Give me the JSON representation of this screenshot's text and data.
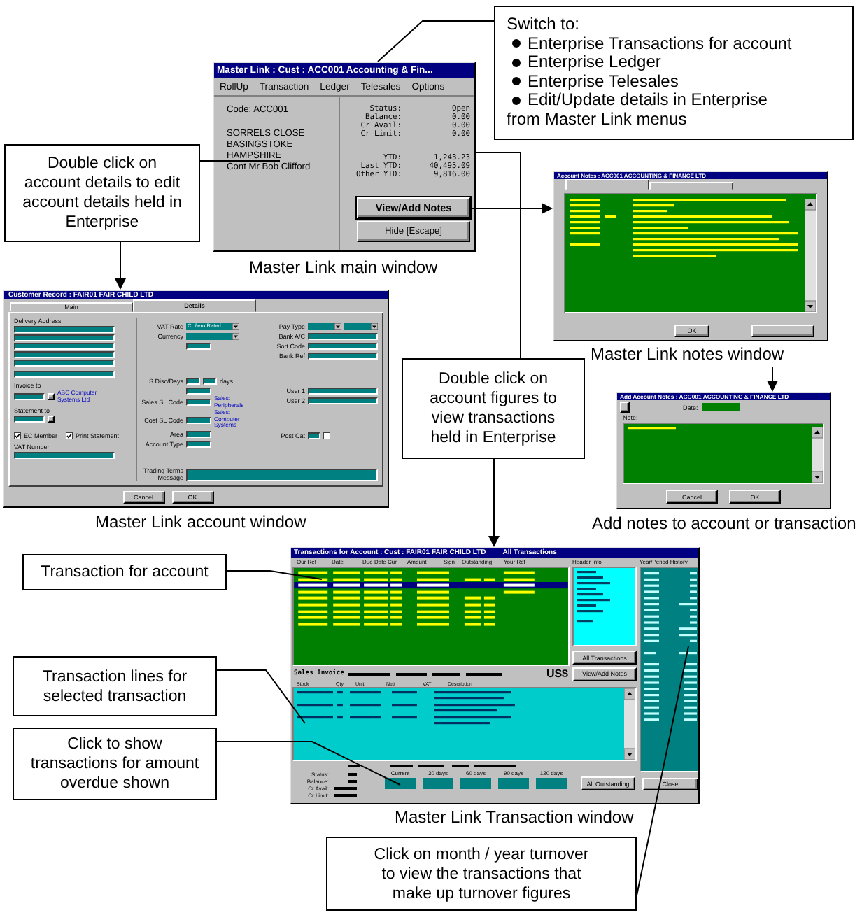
{
  "switch_note": {
    "heading": "Switch to:",
    "items": [
      "Enterprise Transactions for account",
      "Enterprise Ledger",
      "Enterprise Telesales",
      "Edit/Update details in Enterprise"
    ],
    "footer": "from Master Link menus"
  },
  "callouts": [
    {
      "text": "Double click on account details to edit account details held in Enterprise"
    },
    {
      "text": "Double click on account figures to view transactions held in Enterprise"
    },
    {
      "text": "Transaction for account"
    },
    {
      "text": "Transaction lines for selected transaction"
    },
    {
      "text": "Click to show transactions for amount overdue shown"
    },
    {
      "text": "Click on month / year turnover to view the transactions that make up turnover figures"
    }
  ],
  "main_window": {
    "title": "Master Link : Cust : ACC001 Accounting & Fin...",
    "menu": [
      "RollUp",
      "Transaction",
      "Ledger",
      "Telesales",
      "Options"
    ],
    "code": "Code: ACC001",
    "address": [
      "SORRELS CLOSE",
      "BASINGSTOKE",
      "HAMPSHIRE",
      "Cont Mr Bob Clifford"
    ],
    "status_figures": [
      {
        "label": "Status:",
        "value": "Open"
      },
      {
        "label": "Balance:",
        "value": "0.00"
      },
      {
        "label": "Cr Avail:",
        "value": "0.00"
      },
      {
        "label": "Cr Limit:",
        "value": "0.00"
      }
    ],
    "turnover_figures": [
      {
        "label": "YTD:",
        "value": "1,243.23"
      },
      {
        "label": "Last YTD:",
        "value": "40,495.09"
      },
      {
        "label": "Other YTD:",
        "value": "9,816.00"
      }
    ],
    "buttons": [
      {
        "label": "View/Add Notes",
        "default": true
      },
      {
        "label": "Hide [Escape]",
        "default": false
      }
    ],
    "caption": "Master Link main window"
  },
  "account_window": {
    "title": "Customer Record : FAIR01 FAIR CHILD LTD",
    "tabs": [
      {
        "label": "Main",
        "selected": false
      },
      {
        "label": "Details",
        "selected": true
      }
    ],
    "left": [
      [
        {
          "kind": "heading",
          "label": "Delivery Address"
        },
        {
          "kind": "field"
        },
        {
          "kind": "field"
        },
        {
          "kind": "field"
        },
        {
          "kind": "field"
        },
        {
          "kind": "field"
        }
      ],
      [
        {
          "kind": "field"
        }
      ],
      [
        {
          "kind": "heading",
          "label": "Invoice to"
        },
        {
          "kind": "lookup",
          "link": "ABC Computer Systems Ltd"
        }
      ],
      [
        {
          "kind": "heading",
          "label": "Statement to"
        },
        {
          "kind": "lookup"
        }
      ],
      [
        {
          "kind": "checks",
          "items": [
            {
              "label": "EC Member",
              "checked": true
            },
            {
              "label": "Print Statement",
              "checked": true
            }
          ]
        }
      ],
      [
        {
          "kind": "heading",
          "label": "VAT Number"
        },
        {
          "kind": "field"
        }
      ]
    ],
    "middle": [
      [
        {
          "label": "VAT Rate",
          "controls": [
            {
              "kind": "dropdown",
              "value": "C: Zero Rated"
            }
          ]
        },
        {
          "label": "Currency",
          "controls": [
            {
              "kind": "dropdown"
            }
          ]
        },
        {
          "controls": [
            {
              "kind": "field"
            }
          ]
        }
      ],
      [
        {
          "label": "S Disc/Days",
          "controls": [
            {
              "kind": "field"
            },
            {
              "kind": "field"
            }
          ],
          "suffix": "days"
        },
        {
          "controls": [
            {
              "kind": "field"
            }
          ]
        },
        {
          "label": "Sales SL Code",
          "controls": [
            {
              "kind": "field"
            }
          ],
          "link": "Sales: Peripherals"
        },
        {
          "label": "Cost SL Code",
          "controls": [
            {
              "kind": "field"
            }
          ],
          "link": "Sales: Computer Systems"
        },
        {
          "label": "Area",
          "controls": [
            {
              "kind": "field"
            }
          ]
        },
        {
          "label": "Account Type",
          "controls": [
            {
              "kind": "field"
            }
          ]
        }
      ]
    ],
    "right": [
      [
        {
          "label": "Pay Type",
          "controls": [
            {
              "kind": "dropdown"
            },
            {
              "kind": "dropdown"
            }
          ]
        },
        {
          "label": "Bank A/C",
          "controls": [
            {
              "kind": "field"
            }
          ]
        },
        {
          "label": "Sort Code",
          "controls": [
            {
              "kind": "field"
            }
          ]
        },
        {
          "label": "Bank Ref",
          "controls": [
            {
              "kind": "field"
            }
          ]
        }
      ],
      [
        {
          "label": "User 1",
          "controls": [
            {
              "kind": "field"
            }
          ]
        },
        {
          "label": "User 2",
          "controls": [
            {
              "kind": "field"
            }
          ]
        }
      ],
      [
        {
          "label": "Post Cat",
          "controls": [
            {
              "kind": "field"
            },
            {
              "kind": "checkbox",
              "checked": false
            }
          ]
        }
      ]
    ],
    "message": {
      "label": "Trading Terms Message"
    },
    "buttons": [
      "Cancel",
      "OK"
    ],
    "caption": "Master Link account window"
  },
  "notes_window": {
    "title": "Account Notes : ACC001 ACCOUNTING & FINANCE LTD",
    "tabs": [
      {
        "selected": true
      },
      {
        "selected": false
      }
    ],
    "buttons": [
      "OK"
    ],
    "caption": "Master Link notes window"
  },
  "add_notes_window": {
    "title": "Add Account Notes : ACC001 ACCOUNTING & FINANCE LTD",
    "date_label": "Date:",
    "note_label": "Note:",
    "buttons": [
      "Cancel",
      "OK"
    ],
    "caption": "Add notes to account or transaction"
  },
  "transaction_window": {
    "title": "Transactions for Account : Cust : FAIR01 FAIR CHILD LTD",
    "view": "All Transactions",
    "columns": [
      "Our Ref",
      "Date",
      "Due Date",
      "Cur",
      "Amount",
      "Sign",
      "Outstanding",
      "Your Ref"
    ],
    "rows": [
      {
        "selected": false
      },
      {
        "selected": false
      },
      {
        "selected": true
      },
      {
        "selected": false
      },
      {
        "selected": false
      },
      {
        "selected": false
      },
      {
        "selected": false
      },
      {
        "selected": false
      },
      {
        "selected": false
      }
    ],
    "info_title": "Header Info",
    "side_buttons": [
      "All Transactions",
      "View/Add Notes"
    ],
    "invoice_heading": "Sales Invoice",
    "currency": "US$",
    "line_columns": [
      "Stock",
      "Qty",
      "Unit",
      "Nett",
      "VAT",
      "Description"
    ],
    "status_labels": [
      "Status:",
      "Balance:",
      "Cr Avail:",
      "Cr Limit:"
    ],
    "ageing": [
      "Current",
      "30 days",
      "60 days",
      "90 days",
      "120 days"
    ],
    "outstanding_button": "All Outstanding",
    "history_title": "Year/Period History",
    "close_button": "Close",
    "caption": "Master Link Transaction window"
  }
}
